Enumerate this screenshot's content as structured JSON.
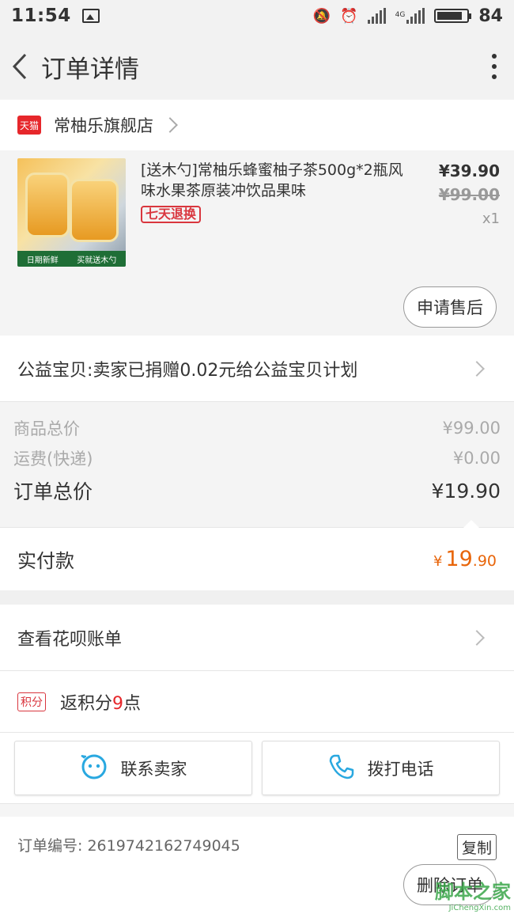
{
  "status_bar": {
    "time": "11:54",
    "network": "4G",
    "battery": "84"
  },
  "header": {
    "title": "订单详情"
  },
  "shop": {
    "badge": "天猫",
    "name": "常柚乐旗舰店"
  },
  "product": {
    "title": "[送木勺]常柚乐蜂蜜柚子茶500g*2瓶风味水果茶原装冲饮品果味",
    "tag": "七天退换",
    "price": "¥39.90",
    "original_price": "¥99.00",
    "quantity": "x1",
    "image_labels": [
      "日期新鲜",
      "买就送木勺"
    ],
    "aftersale_button": "申请售后"
  },
  "charity": {
    "text": "公益宝贝:卖家已捐赠0.02元给公益宝贝计划"
  },
  "summary": {
    "goods_label": "商品总价",
    "goods_value": "¥99.00",
    "shipping_label": "运费(快递)",
    "shipping_value": "¥0.00",
    "total_label": "订单总价",
    "total_value": "¥19.90"
  },
  "payment": {
    "label": "实付款",
    "currency": "¥",
    "integer": "19",
    "decimal": ".90"
  },
  "huabei": {
    "label": "查看花呗账单"
  },
  "points": {
    "badge": "积分",
    "prefix": "返积分",
    "number": "9",
    "suffix": "点"
  },
  "contact": {
    "seller_label": "联系卖家",
    "phone_label": "拨打电话"
  },
  "order": {
    "number_label": "订单编号: 2619742162749045",
    "copy_button": "复制"
  },
  "bottom": {
    "delete_button": "删除订单"
  },
  "watermark": {
    "top": "脚本之家",
    "bottom": "JiChengXin.com"
  },
  "colors": {
    "accent_orange": "#e8650a",
    "tmall_red": "#e6272b",
    "contact_blue": "#29a8e0"
  }
}
